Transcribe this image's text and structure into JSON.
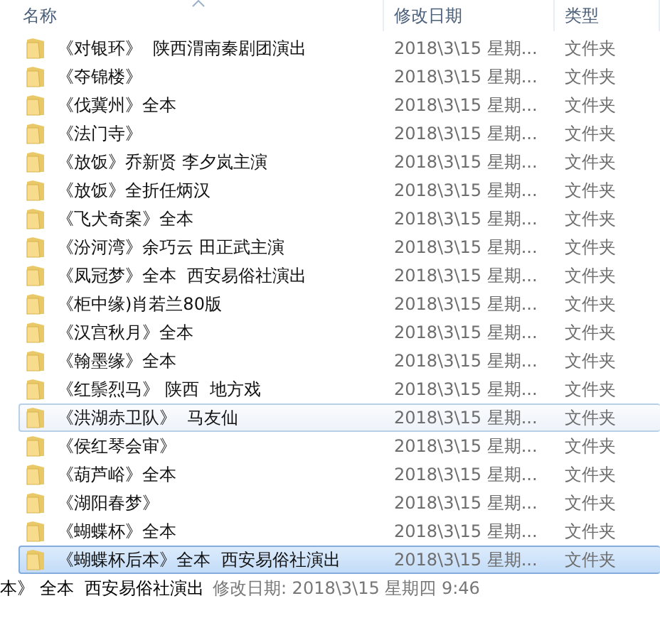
{
  "columns": [
    {
      "label": "名称",
      "sorted": true
    },
    {
      "label": "修改日期",
      "sorted": false
    },
    {
      "label": "类型",
      "sorted": false
    }
  ],
  "rows": [
    {
      "name": "《对银环》  陕西渭南秦剧团演出",
      "date": "2018\\3\\15 星期...",
      "type": "文件夹",
      "selected": false,
      "hovered": false
    },
    {
      "name": "《夺锦楼》",
      "date": "2018\\3\\15 星期...",
      "type": "文件夹",
      "selected": false,
      "hovered": false
    },
    {
      "name": "《伐冀州》全本",
      "date": "2018\\3\\15 星期...",
      "type": "文件夹",
      "selected": false,
      "hovered": false
    },
    {
      "name": "《法门寺》",
      "date": "2018\\3\\15 星期...",
      "type": "文件夹",
      "selected": false,
      "hovered": false
    },
    {
      "name": "《放饭》乔新贤 李夕岚主演",
      "date": "2018\\3\\15 星期...",
      "type": "文件夹",
      "selected": false,
      "hovered": false
    },
    {
      "name": "《放饭》全折任炳汉",
      "date": "2018\\3\\15 星期...",
      "type": "文件夹",
      "selected": false,
      "hovered": false
    },
    {
      "name": "《飞犬奇案》全本",
      "date": "2018\\3\\15 星期...",
      "type": "文件夹",
      "selected": false,
      "hovered": false
    },
    {
      "name": "《汾河湾》余巧云 田正武主演",
      "date": "2018\\3\\15 星期...",
      "type": "文件夹",
      "selected": false,
      "hovered": false
    },
    {
      "name": "《凤冠梦》全本  西安易俗社演出",
      "date": "2018\\3\\15 星期...",
      "type": "文件夹",
      "selected": false,
      "hovered": false
    },
    {
      "name": "《柜中缘)肖若兰80版",
      "date": "2018\\3\\15 星期...",
      "type": "文件夹",
      "selected": false,
      "hovered": false
    },
    {
      "name": "《汉宫秋月》全本",
      "date": "2018\\3\\15 星期...",
      "type": "文件夹",
      "selected": false,
      "hovered": false
    },
    {
      "name": "《翰墨缘》全本",
      "date": "2018\\3\\15 星期...",
      "type": "文件夹",
      "selected": false,
      "hovered": false
    },
    {
      "name": "《红鬃烈马》 陕西  地方戏",
      "date": "2018\\3\\15 星期...",
      "type": "文件夹",
      "selected": false,
      "hovered": false
    },
    {
      "name": "《洪湖赤卫队》  马友仙",
      "date": "2018\\3\\15 星期...",
      "type": "文件夹",
      "selected": false,
      "hovered": true
    },
    {
      "name": "《侯红琴会审》",
      "date": "2018\\3\\15 星期...",
      "type": "文件夹",
      "selected": false,
      "hovered": false
    },
    {
      "name": "《葫芦峪》全本",
      "date": "2018\\3\\15 星期...",
      "type": "文件夹",
      "selected": false,
      "hovered": false
    },
    {
      "name": "《湖阳春梦》",
      "date": "2018\\3\\15 星期...",
      "type": "文件夹",
      "selected": false,
      "hovered": false
    },
    {
      "name": "《蝴蝶杯》全本",
      "date": "2018\\3\\15 星期...",
      "type": "文件夹",
      "selected": false,
      "hovered": false
    },
    {
      "name": "《蝴蝶杯后本》全本  西安易俗社演出",
      "date": "2018\\3\\15 星期...",
      "type": "文件夹",
      "selected": true,
      "hovered": false
    }
  ],
  "tooltip": {
    "name": "本》 全本  西安易俗社演出",
    "detail": "修改日期: 2018\\3\\15 星期四 9:46"
  }
}
